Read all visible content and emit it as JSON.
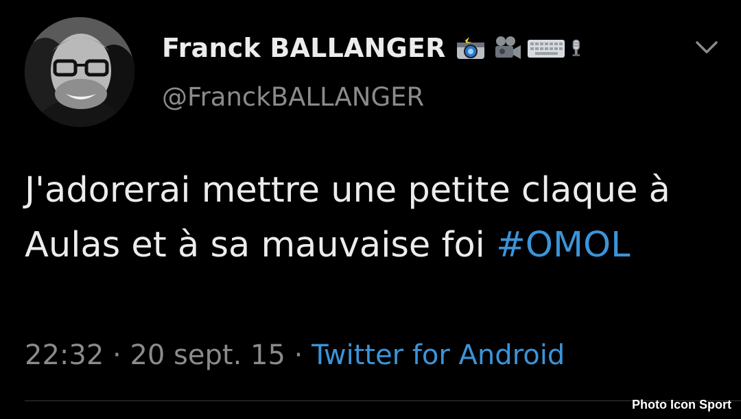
{
  "author": {
    "display_name": "Franck BALLANGER",
    "handle": "@FranckBALLANGER",
    "name_emojis": [
      "camera-flash-icon",
      "movie-camera-icon",
      "keyboard-icon",
      "microphone-icon"
    ]
  },
  "tweet": {
    "text_before_hashtag": "J'adorerai mettre une petite claque à Aulas et à sa mauvaise foi",
    "hashtag": "#OMOL",
    "time": "22:32",
    "separator": "·",
    "date": "20 sept. 15",
    "source": "Twitter for Android"
  },
  "watermark": "Photo Icon Sport",
  "colors": {
    "background": "#000000",
    "text": "#ececec",
    "secondary_text": "#8b8b8b",
    "link": "#3b94d9"
  }
}
